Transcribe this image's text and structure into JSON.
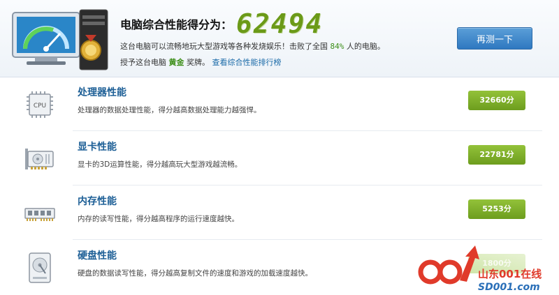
{
  "header": {
    "score_title": "电脑综合性能得分为：",
    "score_value": "62494",
    "line1_before": "这台电脑可以流畅地玩大型游戏等各种发烧娱乐！击败了全国 ",
    "line1_percent": "84%",
    "line1_after": " 人的电脑。",
    "line2_before": "授予这台电脑 ",
    "line2_medal": "黄金",
    "line2_middle": " 奖牌。",
    "line2_link": "查看综合性能排行榜",
    "retest_button": "再测一下"
  },
  "items": [
    {
      "title": "处理器性能",
      "desc": "处理器的数据处理性能，得分越高数据处理能力越强悍。",
      "score": "32660分",
      "icon": "cpu-icon",
      "icon_text": "CPU"
    },
    {
      "title": "显卡性能",
      "desc": "显卡的3D运算性能，得分越高玩大型游戏越流畅。",
      "score": "22781分",
      "icon": "graphics-card-icon"
    },
    {
      "title": "内存性能",
      "desc": "内存的读写性能，得分越高程序的运行速度越快。",
      "score": "5253分",
      "icon": "memory-icon"
    },
    {
      "title": "硬盘性能",
      "desc": "硬盘的数据读写性能，得分越高复制文件的速度和游戏的加载速度越快。",
      "score": "1800分",
      "icon": "hard-disk-icon"
    }
  ],
  "watermark": {
    "line1": "山东001在线",
    "line2": "SD001.com"
  },
  "colors": {
    "accent_green": "#6d9d1e",
    "title_blue": "#1d5f96",
    "button_blue": "#2f78c0",
    "watermark_red": "#e03a2a"
  }
}
